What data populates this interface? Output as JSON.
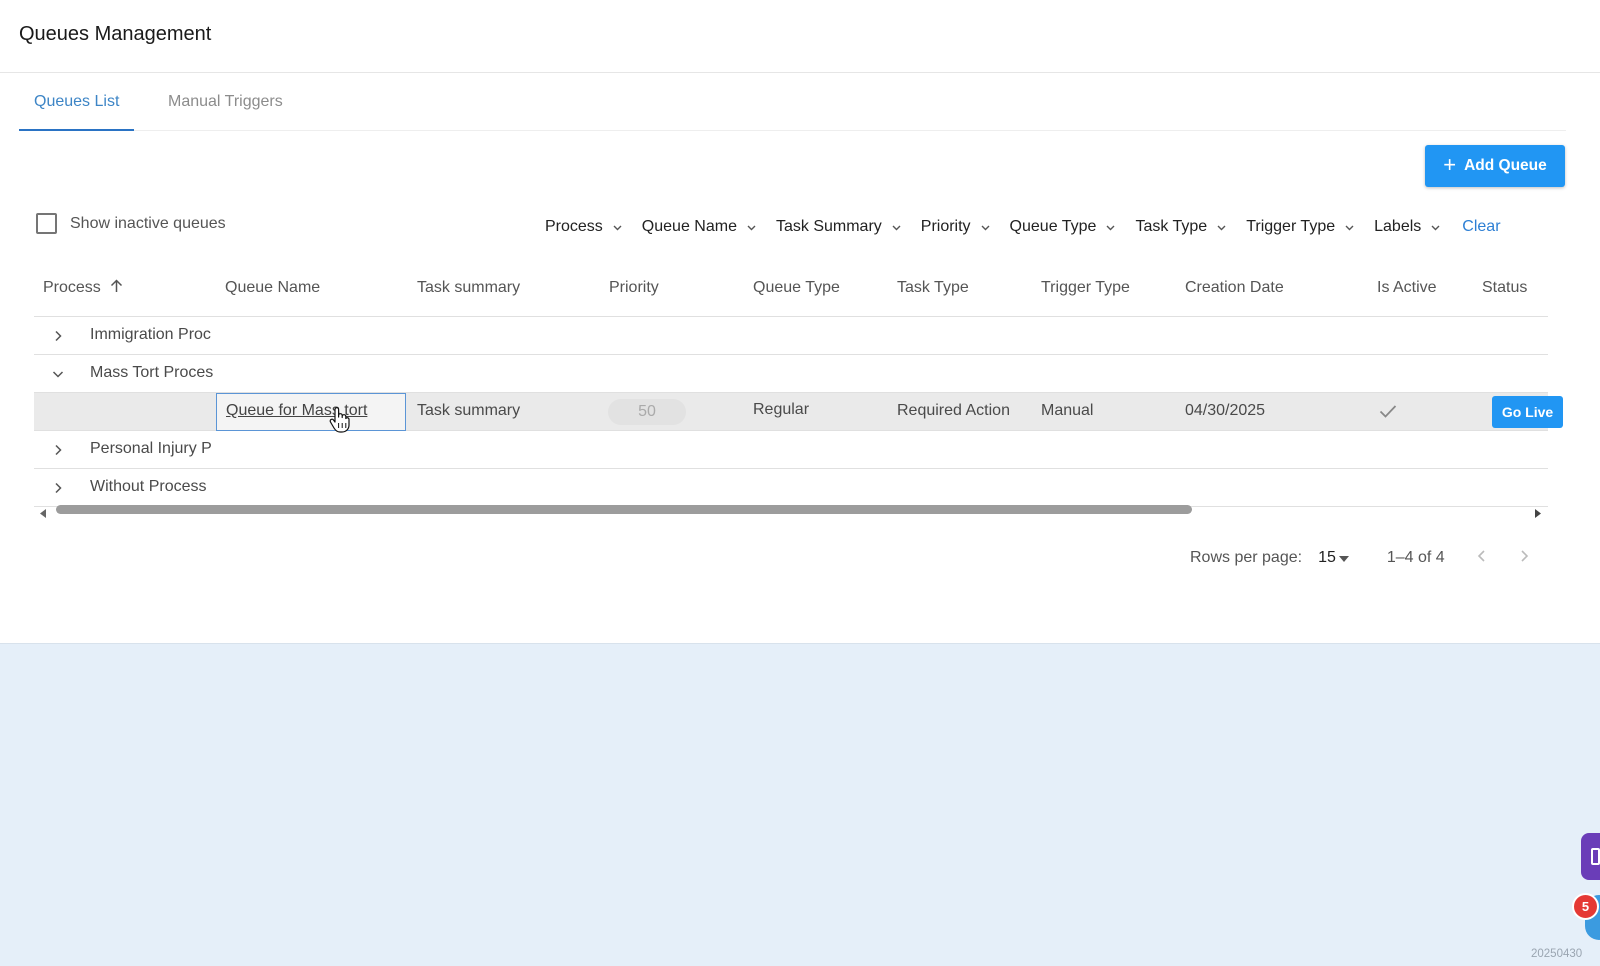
{
  "header": {
    "title": "Queues Management"
  },
  "tabs": [
    {
      "label": "Queues List",
      "active": true
    },
    {
      "label": "Manual Triggers",
      "active": false
    }
  ],
  "add_button": {
    "label": "Add Queue",
    "icon": "plus-icon"
  },
  "show_inactive": {
    "label": "Show inactive queues",
    "checked": false
  },
  "filters": {
    "items": [
      "Process",
      "Queue Name",
      "Task Summary",
      "Priority",
      "Queue Type",
      "Task Type",
      "Trigger Type",
      "Labels"
    ],
    "clear_label": "Clear"
  },
  "table": {
    "columns": [
      "Process",
      "Queue Name",
      "Task summary",
      "Priority",
      "Queue Type",
      "Task Type",
      "Trigger Type",
      "Creation Date",
      "Is Active",
      "Status"
    ],
    "sort": {
      "column": "Process",
      "direction": "ascending"
    },
    "groups": [
      {
        "name": "Immigration Proc",
        "expanded": false
      },
      {
        "name": "Mass Tort Proces",
        "expanded": true
      },
      {
        "name": "Personal Injury P",
        "expanded": false
      },
      {
        "name": "Without Process",
        "expanded": false
      }
    ],
    "detail_row": {
      "queue_name": "Queue for Mass tort",
      "task_summary": "Task summary",
      "priority": "50",
      "queue_type": "Regular",
      "task_type": "Required Action",
      "trigger_type": "Manual",
      "creation_date": "04/30/2025",
      "is_active": true,
      "status_button": "Go Live"
    }
  },
  "pagination": {
    "rows_per_page_label": "Rows per page:",
    "rows_per_page_value": "15",
    "range": "1–4 of 4"
  },
  "horizontal_scroll": {
    "position_fraction": 0.0,
    "visible_fraction": 0.75
  },
  "notification_badge": "5",
  "footer_timestamp": "20250430",
  "colors": {
    "accent": "#2196f3",
    "tab_active": "#3d85c6",
    "link": "#2d7fd4",
    "bottom_background": "#e5eff9",
    "badge": "#e53935",
    "chat_fab": "#6a3db8"
  }
}
